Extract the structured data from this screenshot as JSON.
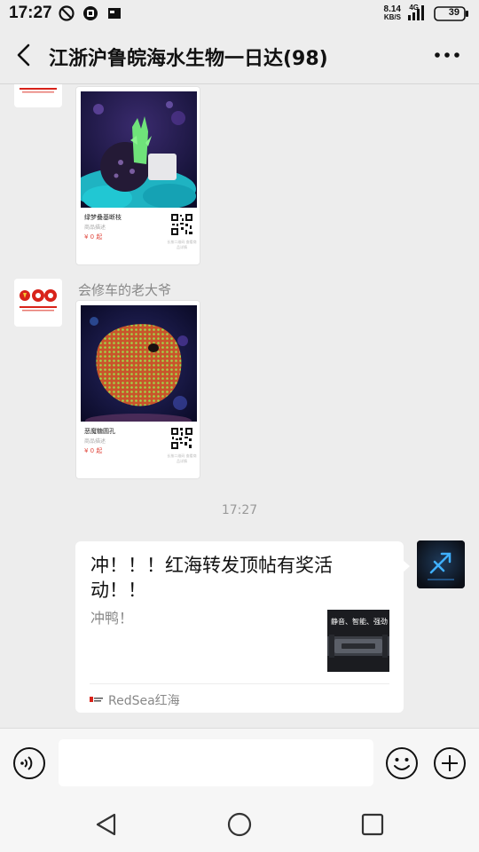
{
  "status_bar": {
    "time": "17:27",
    "net_speed_top": "8.14",
    "net_speed_bottom": "KB/S",
    "network_type": "4G",
    "battery": "39"
  },
  "header": {
    "title": "江浙沪鲁皖海水生物一日达(98)"
  },
  "messages": [
    {
      "type": "product_card",
      "product_name": "绿梦叠基断枝",
      "product_sub": "商品描述",
      "price": "¥ 0 起",
      "qr_tip": "长按二维码 查看商品详情"
    },
    {
      "type": "product_card",
      "sender": "会修车的老大爷",
      "product_name": "恶魔糖圆孔",
      "product_sub": "商品描述",
      "price": "¥ 0 起",
      "qr_tip": "长按二维码 查看商品详情"
    }
  ],
  "timestamp": "17:27",
  "link_card": {
    "title": "冲！！！红海转发顶帖有奖活动！！",
    "description": "冲鸭！",
    "thumb_text": "静音、智能、强劲",
    "source": "RedSea红海",
    "logo_text": "Red Sea"
  },
  "avatars": {
    "badge_text": "100"
  },
  "input": {
    "placeholder": ""
  },
  "colors": {
    "price": "#e0463c",
    "background": "#ededed"
  }
}
